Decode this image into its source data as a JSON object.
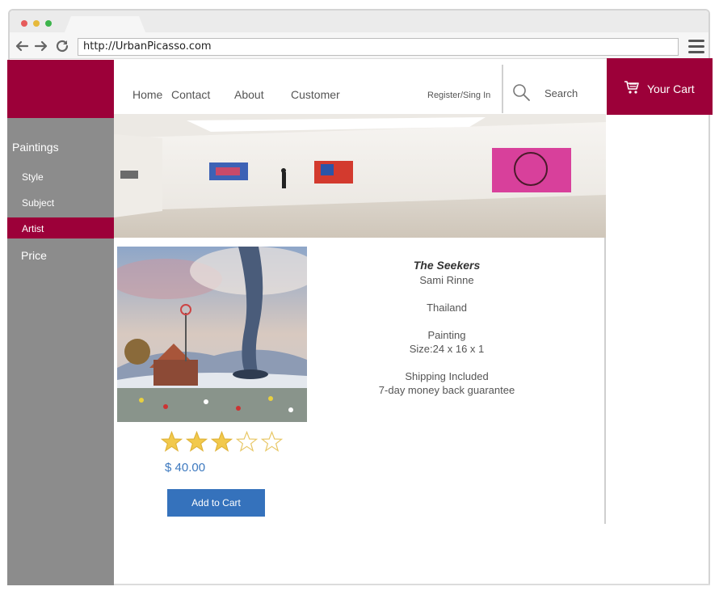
{
  "browser": {
    "url": "http://UrbanPicasso.com",
    "dot_colors": [
      "#e65b5b",
      "#e6b93b",
      "#3cb44b"
    ]
  },
  "header": {
    "nav": [
      "Home",
      "Contact",
      "About",
      "Customer"
    ],
    "register_label": "Register/Sing In",
    "search_label": "Search",
    "cart_label": "Your Cart",
    "brand_color": "#9c0039"
  },
  "sidebar": {
    "heading": "Paintings",
    "items": [
      "Style",
      "Subject",
      "Artist"
    ],
    "selected": "Artist",
    "price_label": "Price"
  },
  "product": {
    "title": "The Seekers",
    "artist": "Sami Rinne",
    "country": "Thailand",
    "medium": "Painting",
    "size": "Size:24 x 16 x 1",
    "shipping": "Shipping Included",
    "guarantee": "7-day money back guarantee",
    "price": "$ 40.00",
    "rating": 3,
    "rating_max": 5,
    "add_button": "Add to Cart"
  },
  "icons": {
    "back": "arrow-left-icon",
    "forward": "arrow-right-icon",
    "reload": "reload-icon",
    "menu": "hamburger-menu-icon",
    "search": "search-icon",
    "cart": "cart-icon",
    "star_filled": "star-filled-icon",
    "star_empty": "star-outline-icon"
  }
}
